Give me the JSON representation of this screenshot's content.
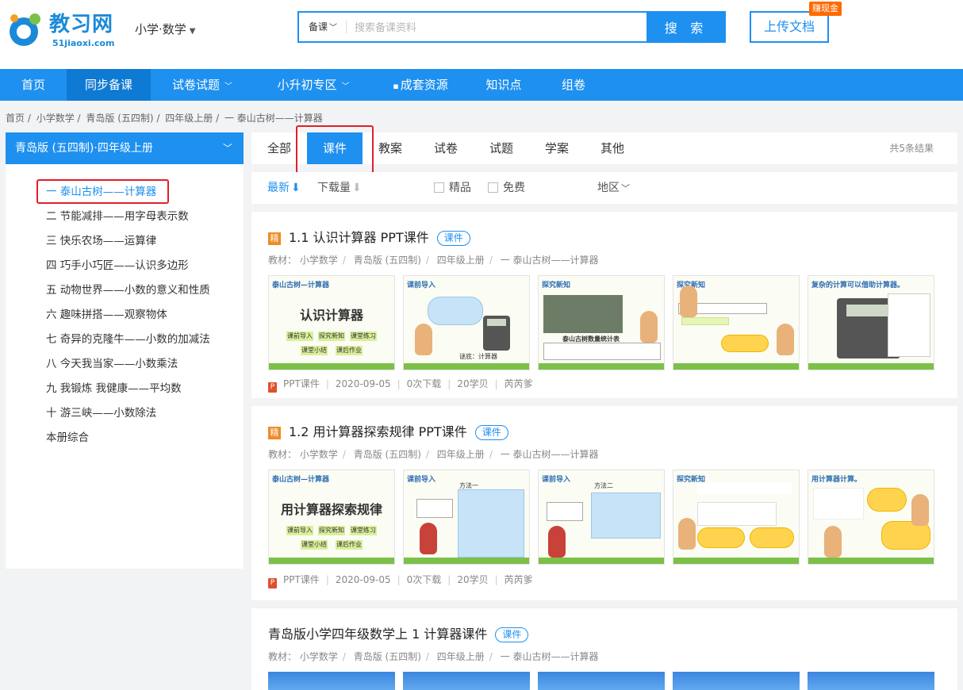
{
  "header": {
    "logo_name": "教习网",
    "logo_domain": "51jiaoxi.com",
    "subject": "小学·数学",
    "search_type": "备课",
    "search_placeholder": "搜索备课资料",
    "search_button": "搜 索",
    "upload_button": "上传文档",
    "earn_badge": "赚现金"
  },
  "nav": [
    "首页",
    "同步备课",
    "试卷试题",
    "小升初专区",
    "成套资源",
    "知识点",
    "组卷"
  ],
  "breadcrumb": [
    "首页 /",
    "小学数学 /",
    "青岛版 (五四制) /",
    "四年级上册 /",
    "一 泰山古树——计算器"
  ],
  "sidebar": {
    "header": "青岛版 (五四制)·四年级上册",
    "items": [
      "一 泰山古树——计算器",
      "二 节能减排——用字母表示数",
      "三 快乐农场——运算律",
      "四 巧手小巧匠——认识多边形",
      "五 动物世界——小数的意义和性质",
      "六 趣味拼搭——观察物体",
      "七 奇异的克隆牛——小数的加减法",
      "八 今天我当家——小数乘法",
      "九 我锻炼 我健康——平均数",
      "十 游三峡——小数除法",
      "本册综合"
    ]
  },
  "tabs": [
    "全部",
    "课件",
    "教案",
    "试卷",
    "试题",
    "学案",
    "其他"
  ],
  "tab_total": "共5条结果",
  "filters": {
    "latest": "最新",
    "downloads": "下载量",
    "premium": "精品",
    "free": "免费",
    "region": "地区"
  },
  "cards": [
    {
      "badge": "精",
      "title": "1.1 认识计算器 PPT课件",
      "type": "课件",
      "meta": [
        "教材：",
        "小学数学",
        "青岛版 (五四制)",
        "四年级上册",
        "一 泰山古树——计算器"
      ],
      "thumbs": [
        {
          "header": "泰山古树—计算器",
          "big": "认识计算器",
          "tags": [
            "课前导入",
            "探究新知",
            "课堂练习",
            "课堂小结",
            "课后作业"
          ]
        },
        {
          "header": "课前导入",
          "caption": "谜底：计算器"
        },
        {
          "header": "探究新知",
          "caption": "泰山古树数量统计表"
        },
        {
          "header": "探究新知"
        },
        {
          "header": "复杂的计算可以借助计算器。"
        }
      ],
      "foot": {
        "format": "PPT课件",
        "date": "2020-09-05",
        "downloads": "0次下载",
        "price": "20学贝",
        "author": "芮芮爹"
      }
    },
    {
      "badge": "精",
      "title": "1.2 用计算器探索规律 PPT课件",
      "type": "课件",
      "meta": [
        "教材：",
        "小学数学",
        "青岛版 (五四制)",
        "四年级上册",
        "一 泰山古树——计算器"
      ],
      "thumbs": [
        {
          "header": "泰山古树—计算器",
          "big": "用计算器探索规律",
          "tags": [
            "课前导入",
            "探究新知",
            "课堂练习",
            "课堂小结",
            "课后作业"
          ]
        },
        {
          "header": "课前导入",
          "caption": "方法一"
        },
        {
          "header": "课前导入",
          "caption": "方法二"
        },
        {
          "header": "探究新知"
        },
        {
          "header": "用计算器计算。"
        }
      ],
      "foot": {
        "format": "PPT课件",
        "date": "2020-09-05",
        "downloads": "0次下载",
        "price": "20学贝",
        "author": "芮芮爹"
      }
    },
    {
      "title": "青岛版小学四年级数学上 1 计算器课件",
      "type": "课件",
      "meta": [
        "教材：",
        "小学数学",
        "青岛版 (五四制)",
        "四年级上册",
        "一 泰山古树——计算器"
      ]
    }
  ]
}
